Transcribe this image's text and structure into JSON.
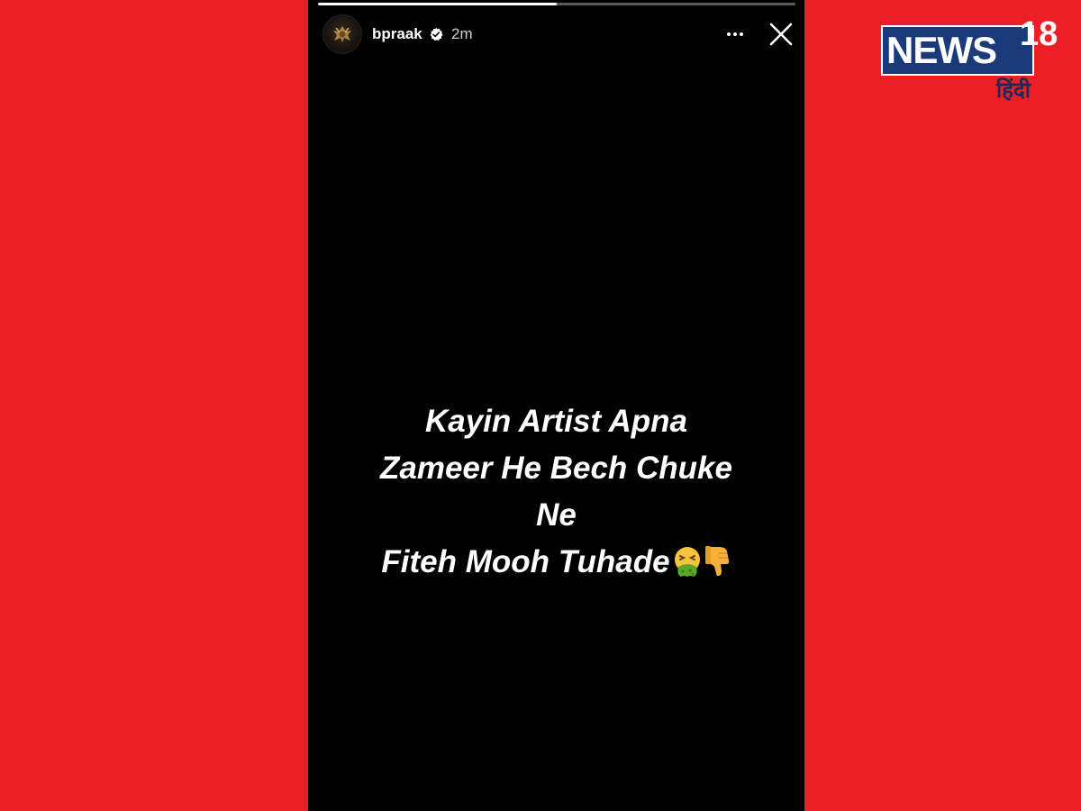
{
  "colors": {
    "background_red": "#ec1f26",
    "story_background": "#000000",
    "logo_blue": "#1a3a7a",
    "text_white": "#ffffff"
  },
  "story": {
    "progress": 0.5,
    "username": "bpraak",
    "verified_icon": "verified-badge-icon",
    "time_ago": "2m",
    "more_icon": "more-options-icon",
    "close_icon": "close-icon",
    "text_lines": [
      "Kayin Artist Apna",
      "Zameer He Bech Chuke",
      "Ne",
      "Fiteh Mooh Tuhade"
    ],
    "emojis": [
      "vomiting-face-emoji",
      "thumbs-down-emoji"
    ]
  },
  "logo": {
    "brand": "NEWS",
    "number": "18",
    "language": "हिंदी"
  }
}
